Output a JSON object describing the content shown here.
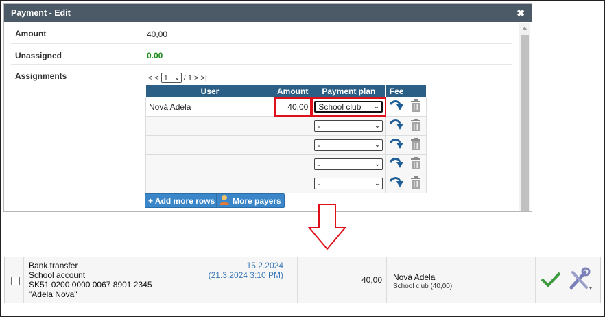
{
  "dialog": {
    "title": "Payment - Edit",
    "close_icon": "close-icon"
  },
  "form": {
    "amount_label": "Amount",
    "amount_value": "40,00",
    "unassigned_label": "Unassigned",
    "unassigned_value": "0.00",
    "assignments_label": "Assignments"
  },
  "pager": {
    "first": "|<",
    "prev": "<",
    "page": "1",
    "sep": "/ 1",
    "next": ">",
    "last": ">|"
  },
  "table": {
    "headers": [
      "User",
      "Amount",
      "Payment plan",
      "Fee"
    ],
    "rows": [
      {
        "user": "Nová Adela",
        "amount": "40,00",
        "plan": "School club"
      },
      {
        "user": "",
        "amount": "",
        "plan": "-"
      },
      {
        "user": "",
        "amount": "",
        "plan": "-"
      },
      {
        "user": "",
        "amount": "",
        "plan": "-"
      },
      {
        "user": "",
        "amount": "",
        "plan": "-"
      }
    ]
  },
  "buttons": {
    "add_rows": "+ Add more rows",
    "more_payers": "More payers"
  },
  "transaction": {
    "line1": "Bank transfer",
    "line2": "School account",
    "line3": "SK51 0200 0000 0067 8901 2345",
    "line4": "\"Adela Nova\"",
    "date": "15.2.2024",
    "datetime": "(21.3.2024 3:10 PM)",
    "amount": "40,00",
    "payer_name": "Nová Adela",
    "payer_detail": "School club (40,00)"
  },
  "colors": {
    "titlebar": "#4b5a66",
    "header": "#2c5f86",
    "highlight": "#e0101a",
    "green": "#1c8a1c",
    "link": "#3b78b7"
  }
}
